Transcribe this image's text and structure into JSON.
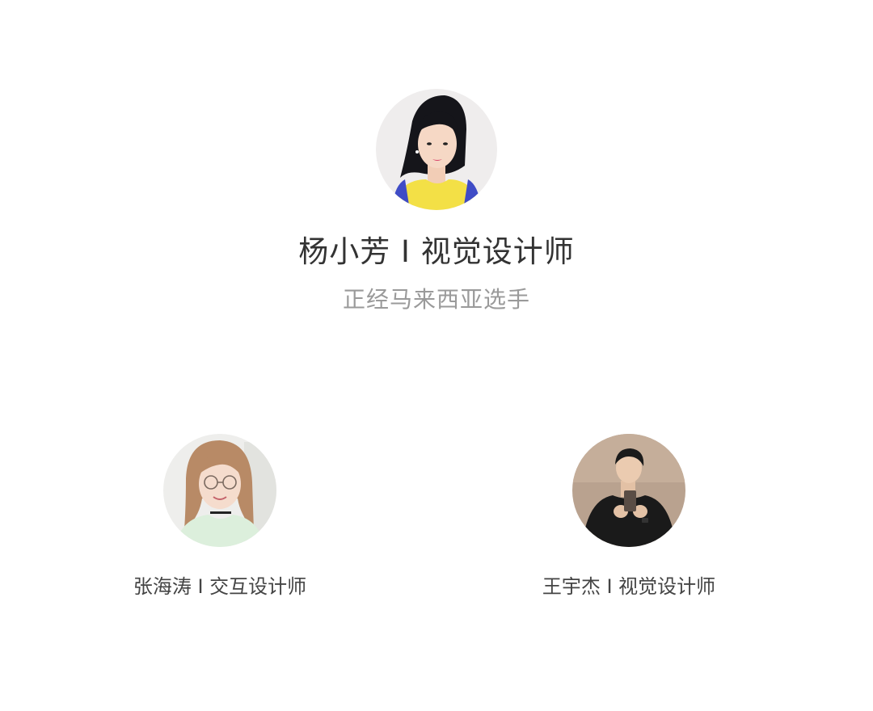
{
  "featured": {
    "name": "杨小芳 I 视觉设计师",
    "tagline": "正经马来西亚选手",
    "avatar_icon": "portrait-woman-yellow-top"
  },
  "members": [
    {
      "name": "张海涛 I 交互设计师",
      "avatar_icon": "portrait-woman-glasses"
    },
    {
      "name": "王宇杰 I 视觉设计师",
      "avatar_icon": "portrait-man-black-shirt"
    }
  ]
}
